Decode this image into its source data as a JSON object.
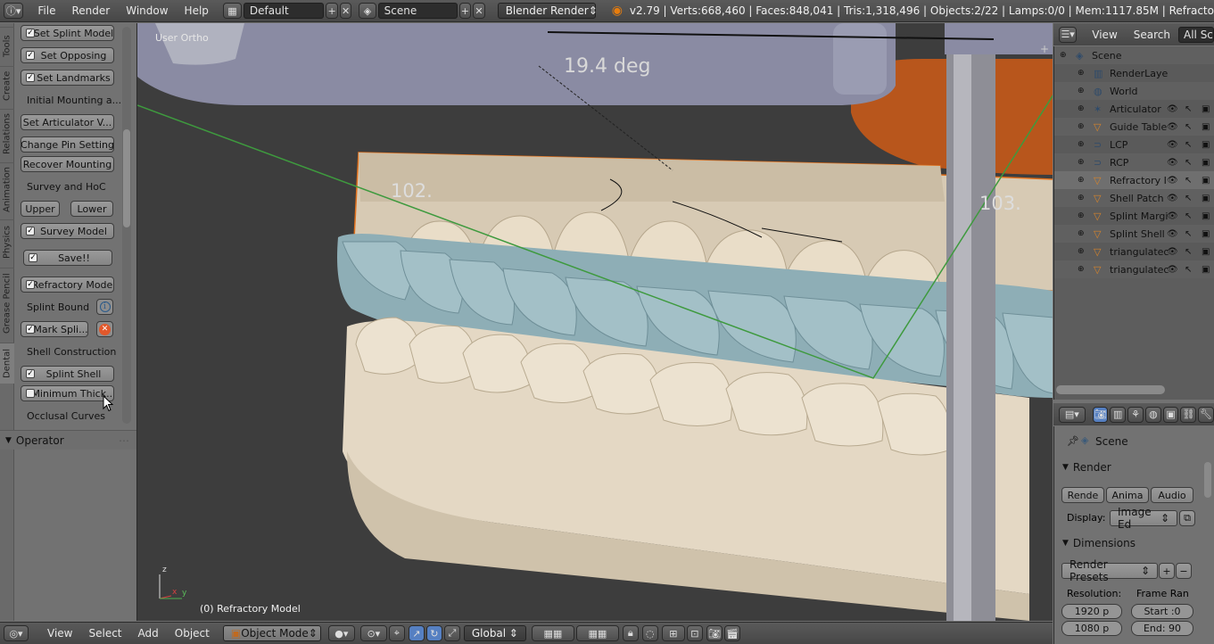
{
  "topbar": {
    "menus": [
      "File",
      "Render",
      "Window",
      "Help"
    ],
    "screen_layout": "Default",
    "scene_name": "Scene",
    "render_engine": "Blender Render",
    "stats": "v2.79 | Verts:668,460 | Faces:848,041 | Tris:1,318,496 | Objects:2/22 | Lamps:0/0 | Mem:1117.85M | Refracto"
  },
  "tabs": [
    "Tools",
    "Create",
    "Relations",
    "Animation",
    "Physics",
    "Grease Pencil",
    "Dental"
  ],
  "toolshelf": {
    "set_splint_model": "Set Splint Model",
    "set_opposing": "Set Opposing",
    "set_landmarks": "Set Landmarks",
    "initial_mounting": "Initial Mounting a...",
    "set_articulator": "Set Articulator V...",
    "change_pin": "Change Pin Setting",
    "recover_mounting": "Recover Mounting",
    "survey_hoc": "Survey and HoC",
    "upper": "Upper",
    "lower": "Lower",
    "survey_model": "Survey Model",
    "save": "Save!!",
    "refractory_model": "Refractory Model",
    "splint_bound": "Splint Bound",
    "mark_splint": "Mark Spli...",
    "shell_construction": "Shell Construction",
    "splint_shell": "Splint Shell",
    "minimum_thick": "Minimum Thick...",
    "occlusal_curves": "Occlusal Curves",
    "operator": "Operator",
    "check": "✓"
  },
  "viewport": {
    "view_label": "User Ortho",
    "angle": "19.4 deg",
    "measure_left": "102.",
    "measure_right": "103.",
    "active_object": "(0) Refractory Model",
    "axis_z": "z",
    "axis_x": "x",
    "axis_y": "y"
  },
  "bottombar": {
    "menus": [
      "View",
      "Select",
      "Add",
      "Object"
    ],
    "mode": "Object Mode",
    "orientation": "Global"
  },
  "outliner": {
    "view": "View",
    "search": "Search",
    "filter": "All Sc",
    "rows": [
      {
        "name": "Scene",
        "icon": "scene-icon"
      },
      {
        "name": "RenderLaye",
        "icon": "render-layers-icon"
      },
      {
        "name": "World",
        "icon": "world-icon"
      },
      {
        "name": "Articulator",
        "icon": "armature-icon"
      },
      {
        "name": "Guide Table",
        "icon": "mesh-icon"
      },
      {
        "name": "LCP",
        "icon": "curve-icon"
      },
      {
        "name": "RCP",
        "icon": "curve-icon"
      },
      {
        "name": "Refractory I",
        "icon": "mesh-icon"
      },
      {
        "name": "Shell Patch",
        "icon": "mesh-icon"
      },
      {
        "name": "Splint Margi",
        "icon": "mesh-icon"
      },
      {
        "name": "Splint Shell",
        "icon": "mesh-icon"
      },
      {
        "name": "triangulatec",
        "icon": "mesh-icon"
      },
      {
        "name": "triangulatec",
        "icon": "mesh-icon"
      }
    ]
  },
  "properties": {
    "context": "Scene",
    "render_panel": "Render",
    "render_btn": "Rende",
    "anim_btn": "Anima",
    "audio_btn": "Audio",
    "display_label": "Display:",
    "display_value": "Image Ed",
    "dimensions_panel": "Dimensions",
    "render_presets": "Render Presets",
    "resolution_label": "Resolution:",
    "frame_range_label": "Frame Ran",
    "res_x": "1920 p",
    "res_y": "1080 p",
    "start": "Start :0",
    "end": "End: 90"
  },
  "colors": {
    "ui_bg": "#727272",
    "viewport_bg": "#3d3d3d",
    "selection_outline": "#e07030",
    "splint_blue": "#8fb0b8",
    "model_cream": "#e6dccb"
  }
}
